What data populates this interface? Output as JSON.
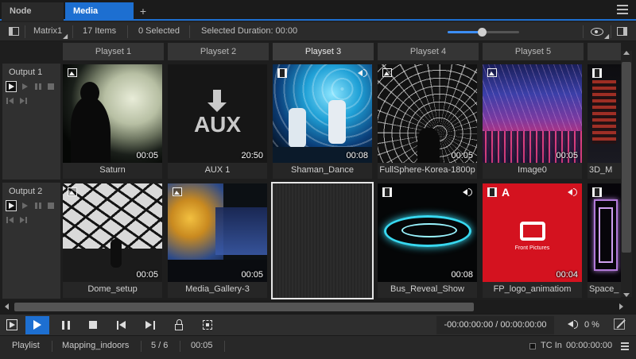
{
  "tabs": [
    {
      "label": "Node Graph"
    },
    {
      "label": "Media Player"
    },
    {
      "label": "+"
    }
  ],
  "toolbar": {
    "matrix": "Matrix1",
    "items_count": "17 Items",
    "selected_count": "0 Selected",
    "selected_duration": "Selected Duration: 00:00",
    "zoom_fraction": 0.48
  },
  "columns": [
    {
      "label": "Playset 1"
    },
    {
      "label": "Playset 2"
    },
    {
      "label": "Playset 3"
    },
    {
      "label": "Playset 4"
    },
    {
      "label": "Playset 5"
    },
    {
      "label": ""
    }
  ],
  "rows": [
    {
      "label": "Output 1",
      "cells": [
        {
          "name": "Saturn",
          "duration": "00:05",
          "kind": "image-icon",
          "sound": false
        },
        {
          "name": "AUX 1",
          "duration": "20:50",
          "kind": "",
          "sound": false,
          "aux_text": "AUX"
        },
        {
          "name": "Shaman_Dance",
          "duration": "00:08",
          "kind": "film-icon",
          "sound": true
        },
        {
          "name": "FullSphere-Korea-1800p",
          "duration": "00:05",
          "kind": "image-icon",
          "sound": false
        },
        {
          "name": "Image0",
          "duration": "00:05",
          "kind": "image-icon",
          "sound": false
        },
        {
          "name": "3D_M",
          "duration": "",
          "kind": "film-icon",
          "sound": false
        }
      ]
    },
    {
      "label": "Output 2",
      "cells": [
        {
          "name": "Dome_setup",
          "duration": "00:05",
          "kind": "image-icon",
          "sound": false
        },
        {
          "name": "Media_Gallery-3",
          "duration": "00:05",
          "kind": "image-icon",
          "sound": false
        },
        {
          "name": "",
          "duration": "",
          "kind": "",
          "sound": false
        },
        {
          "name": "Bus_Reveal_Show",
          "duration": "00:08",
          "kind": "film-icon",
          "sound": true
        },
        {
          "name": "FP_logo_animatiom",
          "duration": "00:04",
          "kind": "film-icon",
          "sound": true,
          "badge": "A",
          "logo_text": "Front Pictures"
        },
        {
          "name": "Space_",
          "duration": "",
          "kind": "film-icon",
          "sound": false
        }
      ]
    }
  ],
  "transport": {
    "timecode": "-00:00:00:00 / 00:00:00:00",
    "volume": "0 %"
  },
  "status": {
    "mode": "Playlist",
    "project": "Mapping_indoors",
    "position": "5 / 6",
    "time": "00:05",
    "tc_label": "TC In",
    "tc_value": "00:00:00:00"
  },
  "colors": {
    "accent": "#1d6fd1",
    "fp_red": "#d4121f"
  }
}
